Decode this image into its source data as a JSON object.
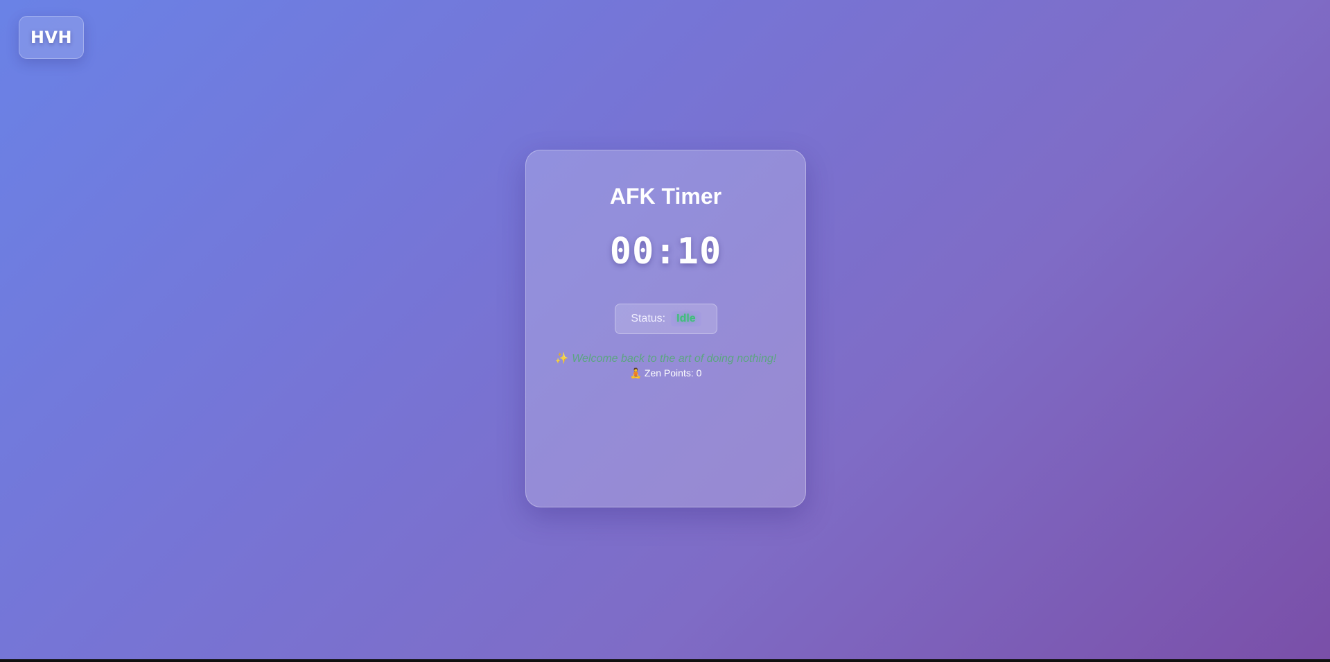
{
  "app": {
    "logo_text": "HVH"
  },
  "card": {
    "title": "AFK Timer",
    "timer": "00:10",
    "status_label": "Status:",
    "status_value": "Idle",
    "welcome_icon": "✨",
    "welcome_text": "Welcome back to the art of doing nothing!",
    "zen_icon": "🧘",
    "zen_text": "Zen Points: 0"
  },
  "colors": {
    "status_idle": "#3fbf7a",
    "welcome_text": "#56a878"
  }
}
